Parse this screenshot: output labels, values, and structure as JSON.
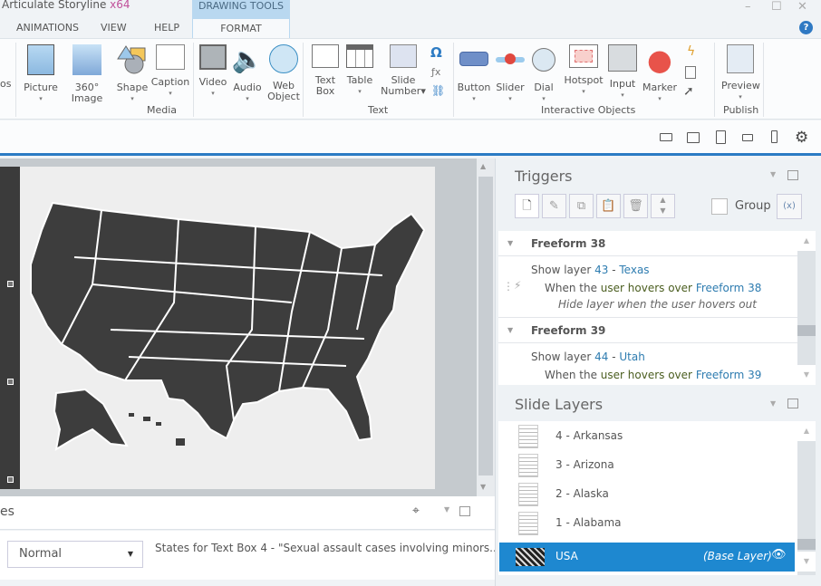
{
  "app": {
    "title": "Articulate Storyline",
    "arch": "x64",
    "context_tab_group": "DRAWING TOOLS"
  },
  "tabs": [
    "ANIMATIONS",
    "VIEW",
    "HELP",
    "FORMAT"
  ],
  "window_controls": {
    "minimize": "–",
    "maximize": "☐",
    "close": "✕",
    "help": "?"
  },
  "ribbon": {
    "partial_label": "os",
    "media": [
      {
        "l1": "Picture",
        "l2": "▾"
      },
      {
        "l1": "360° Image",
        "l2": ""
      },
      {
        "l1": "Shape",
        "l2": "▾"
      },
      {
        "l1": "Caption",
        "l2": "▾"
      },
      {
        "l1": "Video",
        "l2": "▾"
      },
      {
        "l1": "Audio",
        "l2": "▾"
      },
      {
        "l1": "Web",
        "l2": "Object"
      }
    ],
    "media_group": "Media",
    "text": [
      {
        "l1": "Text",
        "l2": "Box"
      },
      {
        "l1": "Table",
        "l2": "▾"
      },
      {
        "l1": "Slide",
        "l2": "Number▾"
      }
    ],
    "text_group": "Text",
    "interactive": [
      {
        "l1": "Button",
        "l2": "▾"
      },
      {
        "l1": "Slider",
        "l2": "▾"
      },
      {
        "l1": "Dial",
        "l2": "▾"
      },
      {
        "l1": "Hotspot",
        "l2": "▾"
      },
      {
        "l1": "Input",
        "l2": "▾"
      },
      {
        "l1": "Marker",
        "l2": "▾"
      }
    ],
    "interactive_group": "Interactive Objects",
    "publish": [
      {
        "l1": "Preview",
        "l2": "▾"
      }
    ],
    "publish_group": "Publish"
  },
  "bottom": {
    "panel_title_partial": "es",
    "state_value": "Normal",
    "states_text": "States for Text Box 4 - \"Sexual assault cases involving minors..."
  },
  "triggers": {
    "title": "Triggers",
    "group_label": "Group",
    "items": [
      {
        "object": "Freeform 38",
        "action": "Show layer",
        "layer_num": "43",
        "layer_name": "Texas",
        "when": "When the",
        "event": "user hovers over",
        "target": "Freeform 38",
        "note": "Hide layer when the user hovers out"
      },
      {
        "object": "Freeform 39",
        "action": "Show layer",
        "layer_num": "44",
        "layer_name": "Utah",
        "when": "When the",
        "event": "user hovers over",
        "target": "Freeform 39"
      }
    ]
  },
  "slide_layers": {
    "title": "Slide Layers",
    "items": [
      "4 - Arkansas",
      "3 - Arizona",
      "2 - Alaska",
      "1 - Alabama"
    ],
    "base": {
      "name": "USA",
      "tag": "(Base Layer)"
    }
  },
  "colors": {
    "accent": "#2b7bc4",
    "selected": "#1e88d0",
    "map": "#3d3d3d"
  }
}
